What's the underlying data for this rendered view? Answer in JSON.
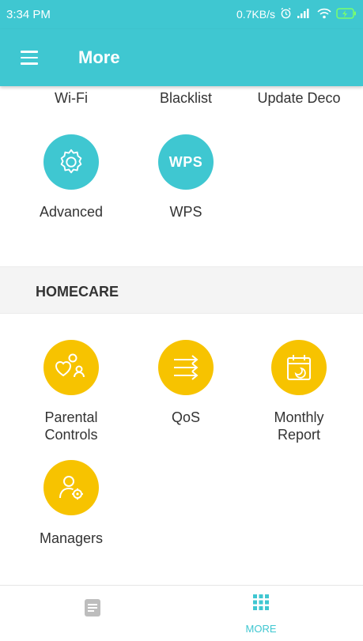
{
  "status_bar": {
    "time": "3:34 PM",
    "network_speed": "0.7KB/s",
    "icons": [
      "alarm-icon",
      "signal-icon",
      "wifi-icon",
      "battery-charging-icon"
    ]
  },
  "app_bar": {
    "title": "More",
    "menu_icon": "hamburger-menu-icon"
  },
  "top_row_labels": [
    "Wi-Fi",
    "Blacklist",
    "Update Deco"
  ],
  "network_items": [
    {
      "label": "Advanced",
      "icon": "gear-icon",
      "color": "#3fc7d1"
    },
    {
      "label": "WPS",
      "icon": "wps-icon",
      "icon_text": "WPS",
      "color": "#3fc7d1"
    }
  ],
  "homecare": {
    "section_title": "HOMECARE",
    "items": [
      {
        "label": "Parental\nControls",
        "icon": "parental-controls-icon",
        "color": "#f7c300"
      },
      {
        "label": "QoS",
        "icon": "qos-arrows-icon",
        "color": "#f7c300"
      },
      {
        "label": "Monthly\nReport",
        "icon": "calendar-report-icon",
        "color": "#f7c300"
      },
      {
        "label": "Managers",
        "icon": "manager-user-gear-icon",
        "color": "#f7c300"
      }
    ]
  },
  "bottom_nav": {
    "items": [
      {
        "label": "",
        "icon": "document-list-icon",
        "active": false
      },
      {
        "label": "MORE",
        "icon": "grid-dots-icon",
        "active": true
      }
    ]
  },
  "colors": {
    "accent": "#3fc7d1",
    "homecare_yellow": "#f7c300",
    "inactive_icon": "#bdbdbd"
  }
}
